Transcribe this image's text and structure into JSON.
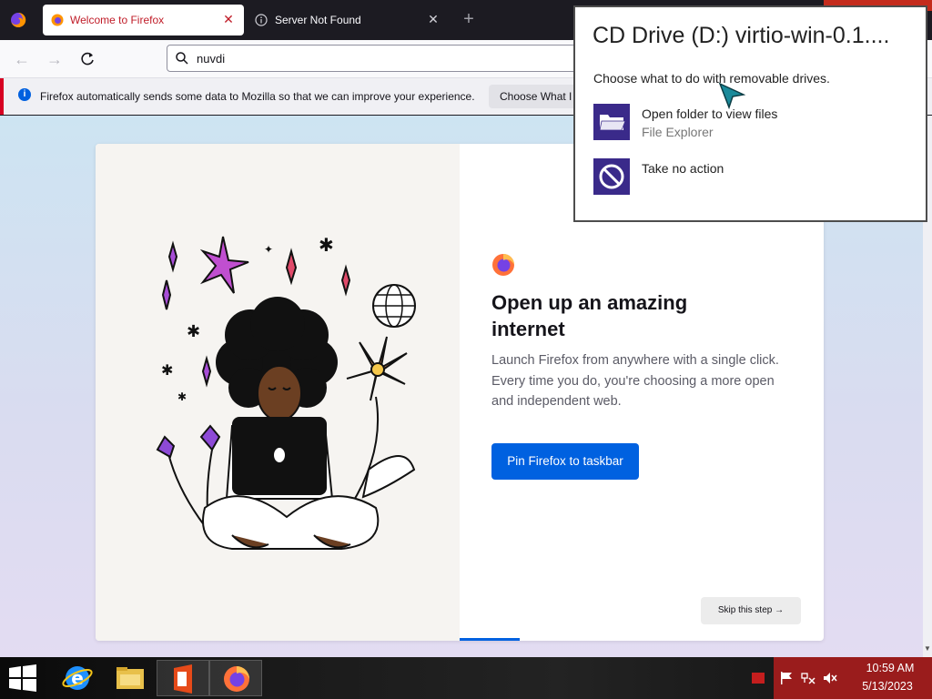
{
  "browser": {
    "tabs": [
      {
        "title": "Welcome to Firefox",
        "active": true
      },
      {
        "title": "Server Not Found",
        "active": false
      }
    ],
    "url": "nuvdi",
    "notification": {
      "text": "Firefox automatically sends some data to Mozilla so that we can improve your experience.",
      "button": "Choose What I Share"
    }
  },
  "welcome": {
    "heading": "Open up an amazing internet",
    "body": "Launch Firefox from anywhere with a single click. Every time you do, you're choosing a more open and independent web.",
    "pin_button": "Pin Firefox to taskbar",
    "skip_button": "Skip this step →",
    "progress_step": 1
  },
  "autoplay": {
    "title": "CD Drive (D:) virtio-win-0.1....",
    "subtitle": "Choose what to do with removable drives.",
    "options": [
      {
        "label": "Open folder to view files",
        "sub": "File Explorer",
        "icon": "folder-icon"
      },
      {
        "label": "Take no action",
        "sub": "",
        "icon": "no-action-icon"
      }
    ]
  },
  "taskbar": {
    "apps": [
      "internet-explorer-icon",
      "file-explorer-icon",
      "office-icon",
      "firefox-icon"
    ],
    "time": "10:59 AM",
    "date": "5/13/2023"
  },
  "colors": {
    "accent": "#0061e0",
    "tray": "#9a1c1c",
    "active_tab_text": "#c01c28",
    "notification_bar": "#d70022"
  }
}
